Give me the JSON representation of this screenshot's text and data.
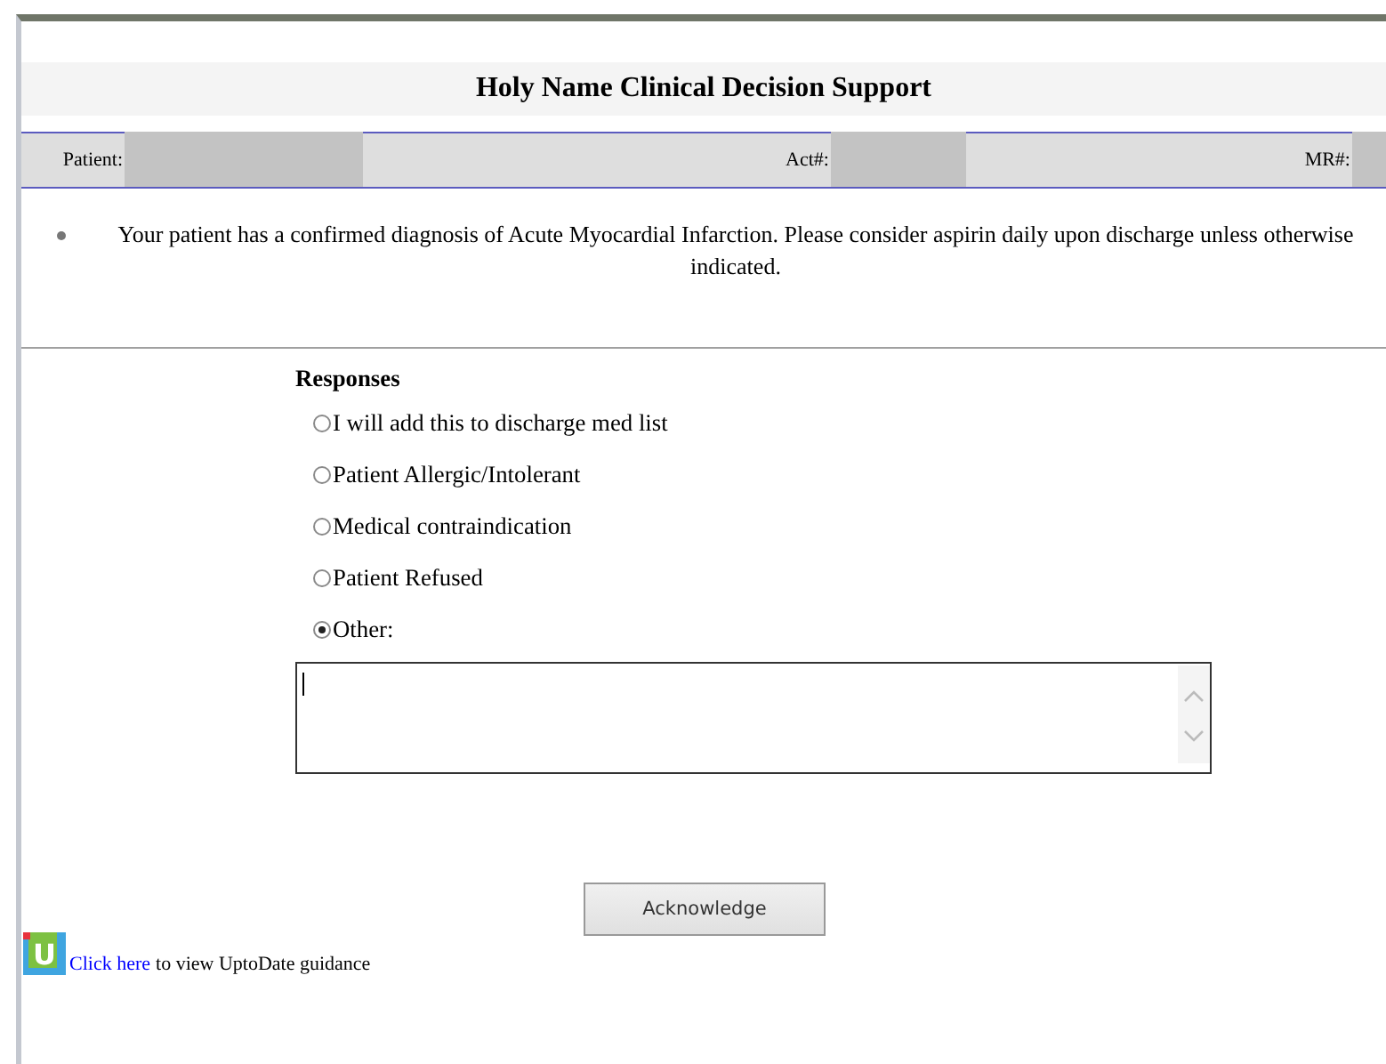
{
  "title": "Holy Name Clinical Decision Support",
  "patient_bar": [
    {
      "label": "Patient:"
    },
    {
      "label": "Act#:"
    },
    {
      "label": "MR#:"
    }
  ],
  "alert": "Your patient has a confirmed diagnosis of Acute Myocardial Infarction. Please consider aspirin daily upon discharge unless otherwise indicated.",
  "responses": {
    "heading": "Responses",
    "options": [
      {
        "label": "I will add this to discharge med list",
        "selected": false
      },
      {
        "label": "Patient Allergic/Intolerant",
        "selected": false
      },
      {
        "label": "Medical contraindication",
        "selected": false
      },
      {
        "label": "Patient Refused",
        "selected": false
      },
      {
        "label": "Other:",
        "selected": true
      }
    ]
  },
  "button": "Acknowledge",
  "footer": {
    "logo_letter": "U",
    "link": "Click here",
    "text": "to view UptoDate guidance"
  }
}
